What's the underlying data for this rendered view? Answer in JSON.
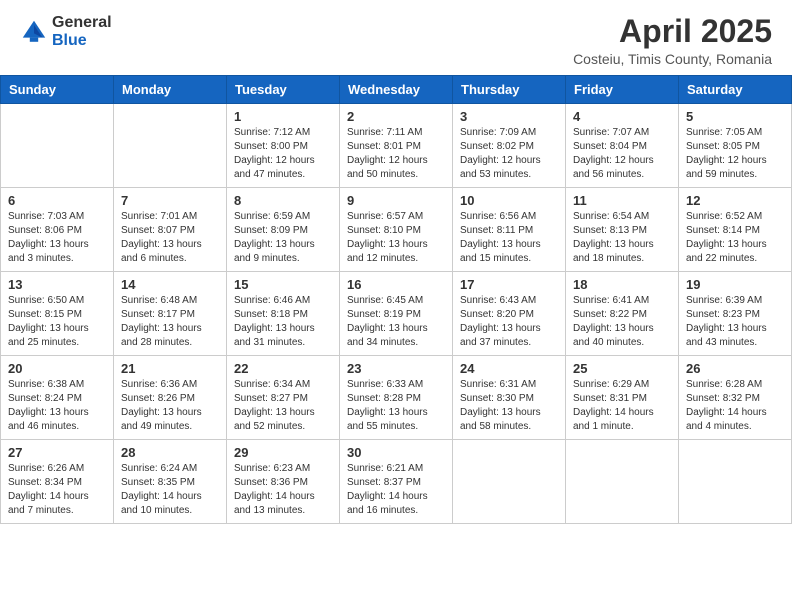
{
  "logo": {
    "general": "General",
    "blue": "Blue"
  },
  "header": {
    "month": "April 2025",
    "location": "Costeiu, Timis County, Romania"
  },
  "days_of_week": [
    "Sunday",
    "Monday",
    "Tuesday",
    "Wednesday",
    "Thursday",
    "Friday",
    "Saturday"
  ],
  "weeks": [
    [
      {
        "day": "",
        "info": ""
      },
      {
        "day": "",
        "info": ""
      },
      {
        "day": "1",
        "info": "Sunrise: 7:12 AM\nSunset: 8:00 PM\nDaylight: 12 hours and 47 minutes."
      },
      {
        "day": "2",
        "info": "Sunrise: 7:11 AM\nSunset: 8:01 PM\nDaylight: 12 hours and 50 minutes."
      },
      {
        "day": "3",
        "info": "Sunrise: 7:09 AM\nSunset: 8:02 PM\nDaylight: 12 hours and 53 minutes."
      },
      {
        "day": "4",
        "info": "Sunrise: 7:07 AM\nSunset: 8:04 PM\nDaylight: 12 hours and 56 minutes."
      },
      {
        "day": "5",
        "info": "Sunrise: 7:05 AM\nSunset: 8:05 PM\nDaylight: 12 hours and 59 minutes."
      }
    ],
    [
      {
        "day": "6",
        "info": "Sunrise: 7:03 AM\nSunset: 8:06 PM\nDaylight: 13 hours and 3 minutes."
      },
      {
        "day": "7",
        "info": "Sunrise: 7:01 AM\nSunset: 8:07 PM\nDaylight: 13 hours and 6 minutes."
      },
      {
        "day": "8",
        "info": "Sunrise: 6:59 AM\nSunset: 8:09 PM\nDaylight: 13 hours and 9 minutes."
      },
      {
        "day": "9",
        "info": "Sunrise: 6:57 AM\nSunset: 8:10 PM\nDaylight: 13 hours and 12 minutes."
      },
      {
        "day": "10",
        "info": "Sunrise: 6:56 AM\nSunset: 8:11 PM\nDaylight: 13 hours and 15 minutes."
      },
      {
        "day": "11",
        "info": "Sunrise: 6:54 AM\nSunset: 8:13 PM\nDaylight: 13 hours and 18 minutes."
      },
      {
        "day": "12",
        "info": "Sunrise: 6:52 AM\nSunset: 8:14 PM\nDaylight: 13 hours and 22 minutes."
      }
    ],
    [
      {
        "day": "13",
        "info": "Sunrise: 6:50 AM\nSunset: 8:15 PM\nDaylight: 13 hours and 25 minutes."
      },
      {
        "day": "14",
        "info": "Sunrise: 6:48 AM\nSunset: 8:17 PM\nDaylight: 13 hours and 28 minutes."
      },
      {
        "day": "15",
        "info": "Sunrise: 6:46 AM\nSunset: 8:18 PM\nDaylight: 13 hours and 31 minutes."
      },
      {
        "day": "16",
        "info": "Sunrise: 6:45 AM\nSunset: 8:19 PM\nDaylight: 13 hours and 34 minutes."
      },
      {
        "day": "17",
        "info": "Sunrise: 6:43 AM\nSunset: 8:20 PM\nDaylight: 13 hours and 37 minutes."
      },
      {
        "day": "18",
        "info": "Sunrise: 6:41 AM\nSunset: 8:22 PM\nDaylight: 13 hours and 40 minutes."
      },
      {
        "day": "19",
        "info": "Sunrise: 6:39 AM\nSunset: 8:23 PM\nDaylight: 13 hours and 43 minutes."
      }
    ],
    [
      {
        "day": "20",
        "info": "Sunrise: 6:38 AM\nSunset: 8:24 PM\nDaylight: 13 hours and 46 minutes."
      },
      {
        "day": "21",
        "info": "Sunrise: 6:36 AM\nSunset: 8:26 PM\nDaylight: 13 hours and 49 minutes."
      },
      {
        "day": "22",
        "info": "Sunrise: 6:34 AM\nSunset: 8:27 PM\nDaylight: 13 hours and 52 minutes."
      },
      {
        "day": "23",
        "info": "Sunrise: 6:33 AM\nSunset: 8:28 PM\nDaylight: 13 hours and 55 minutes."
      },
      {
        "day": "24",
        "info": "Sunrise: 6:31 AM\nSunset: 8:30 PM\nDaylight: 13 hours and 58 minutes."
      },
      {
        "day": "25",
        "info": "Sunrise: 6:29 AM\nSunset: 8:31 PM\nDaylight: 14 hours and 1 minute."
      },
      {
        "day": "26",
        "info": "Sunrise: 6:28 AM\nSunset: 8:32 PM\nDaylight: 14 hours and 4 minutes."
      }
    ],
    [
      {
        "day": "27",
        "info": "Sunrise: 6:26 AM\nSunset: 8:34 PM\nDaylight: 14 hours and 7 minutes."
      },
      {
        "day": "28",
        "info": "Sunrise: 6:24 AM\nSunset: 8:35 PM\nDaylight: 14 hours and 10 minutes."
      },
      {
        "day": "29",
        "info": "Sunrise: 6:23 AM\nSunset: 8:36 PM\nDaylight: 14 hours and 13 minutes."
      },
      {
        "day": "30",
        "info": "Sunrise: 6:21 AM\nSunset: 8:37 PM\nDaylight: 14 hours and 16 minutes."
      },
      {
        "day": "",
        "info": ""
      },
      {
        "day": "",
        "info": ""
      },
      {
        "day": "",
        "info": ""
      }
    ]
  ]
}
